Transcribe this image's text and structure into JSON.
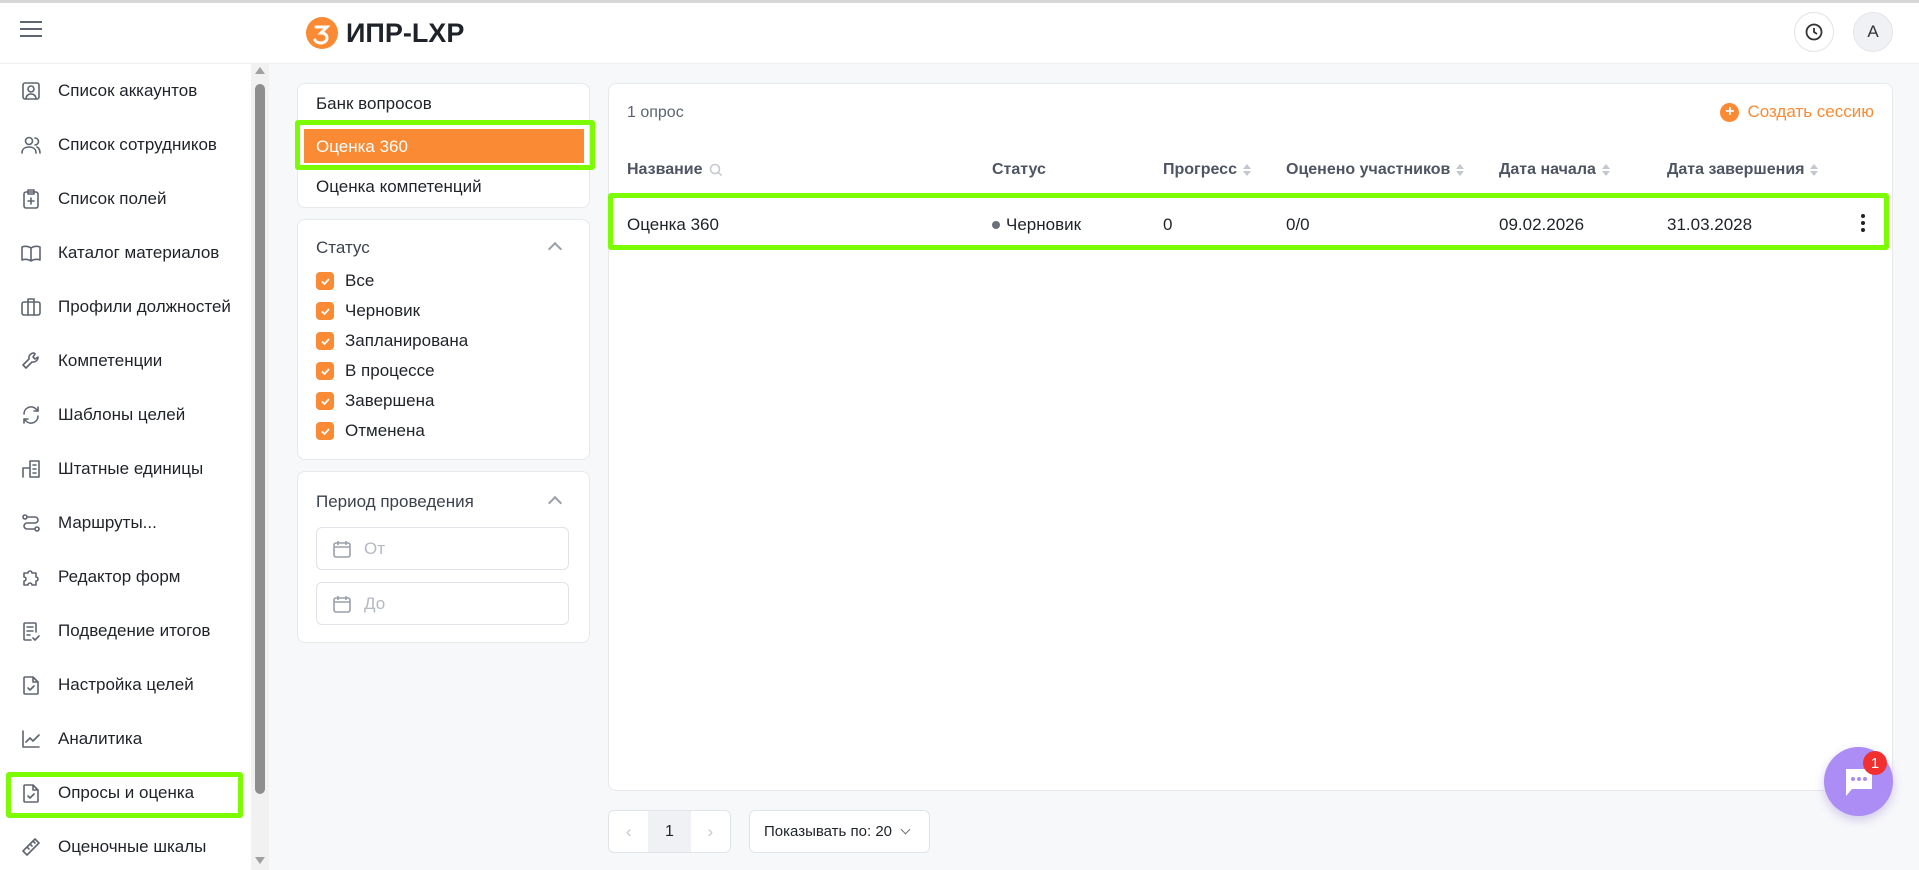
{
  "header": {
    "logo_text": "ИПР-LXP",
    "avatar": "A",
    "brand_color": "#fa8a33"
  },
  "sidebar": {
    "items": [
      {
        "label": "Список аккаунтов",
        "icon": "account-icon"
      },
      {
        "label": "Список сотрудников",
        "icon": "users-icon"
      },
      {
        "label": "Список полей",
        "icon": "clipboard-plus-icon"
      },
      {
        "label": "Каталог материалов",
        "icon": "book-icon"
      },
      {
        "label": "Профили должностей",
        "icon": "briefcase-icon"
      },
      {
        "label": "Компетенции",
        "icon": "wrench-icon"
      },
      {
        "label": "Шаблоны целей",
        "icon": "refresh-icon"
      },
      {
        "label": "Штатные единицы",
        "icon": "building-icon"
      },
      {
        "label": "Маршруты...",
        "icon": "route-icon"
      },
      {
        "label": "Редактор форм",
        "icon": "puzzle-icon"
      },
      {
        "label": "Подведение итогов",
        "icon": "document-check-icon"
      },
      {
        "label": "Настройка целей",
        "icon": "file-check-icon"
      },
      {
        "label": "Аналитика",
        "icon": "chart-icon"
      },
      {
        "label": "Опросы и оценка",
        "icon": "file-check-icon"
      },
      {
        "label": "Оценочные шкалы",
        "icon": "ruler-icon"
      }
    ],
    "active_index": 13
  },
  "subnav": {
    "items": [
      "Банк вопросов",
      "Оценка 360",
      "Оценка компетенций"
    ],
    "active_index": 1
  },
  "filters": {
    "status_title": "Статус",
    "statuses": [
      "Все",
      "Черновик",
      "Запланирована",
      "В процессе",
      "Завершена",
      "Отменена"
    ],
    "period_title": "Период проведения",
    "from_placeholder": "От",
    "to_placeholder": "До"
  },
  "table": {
    "count": "1 опрос",
    "create_label": "Создать сессию",
    "columns": [
      "Название",
      "Статус",
      "Прогресс",
      "Оценено участников",
      "Дата начала",
      "Дата завершения"
    ],
    "rows": [
      {
        "name": "Оценка 360",
        "status": "Черновик",
        "progress": "0",
        "rated": "0/0",
        "start": "09.02.2026",
        "end": "31.03.2028"
      }
    ]
  },
  "pagination": {
    "page": "1",
    "page_size_label": "Показывать по: 20"
  },
  "chat": {
    "badge": "1"
  }
}
